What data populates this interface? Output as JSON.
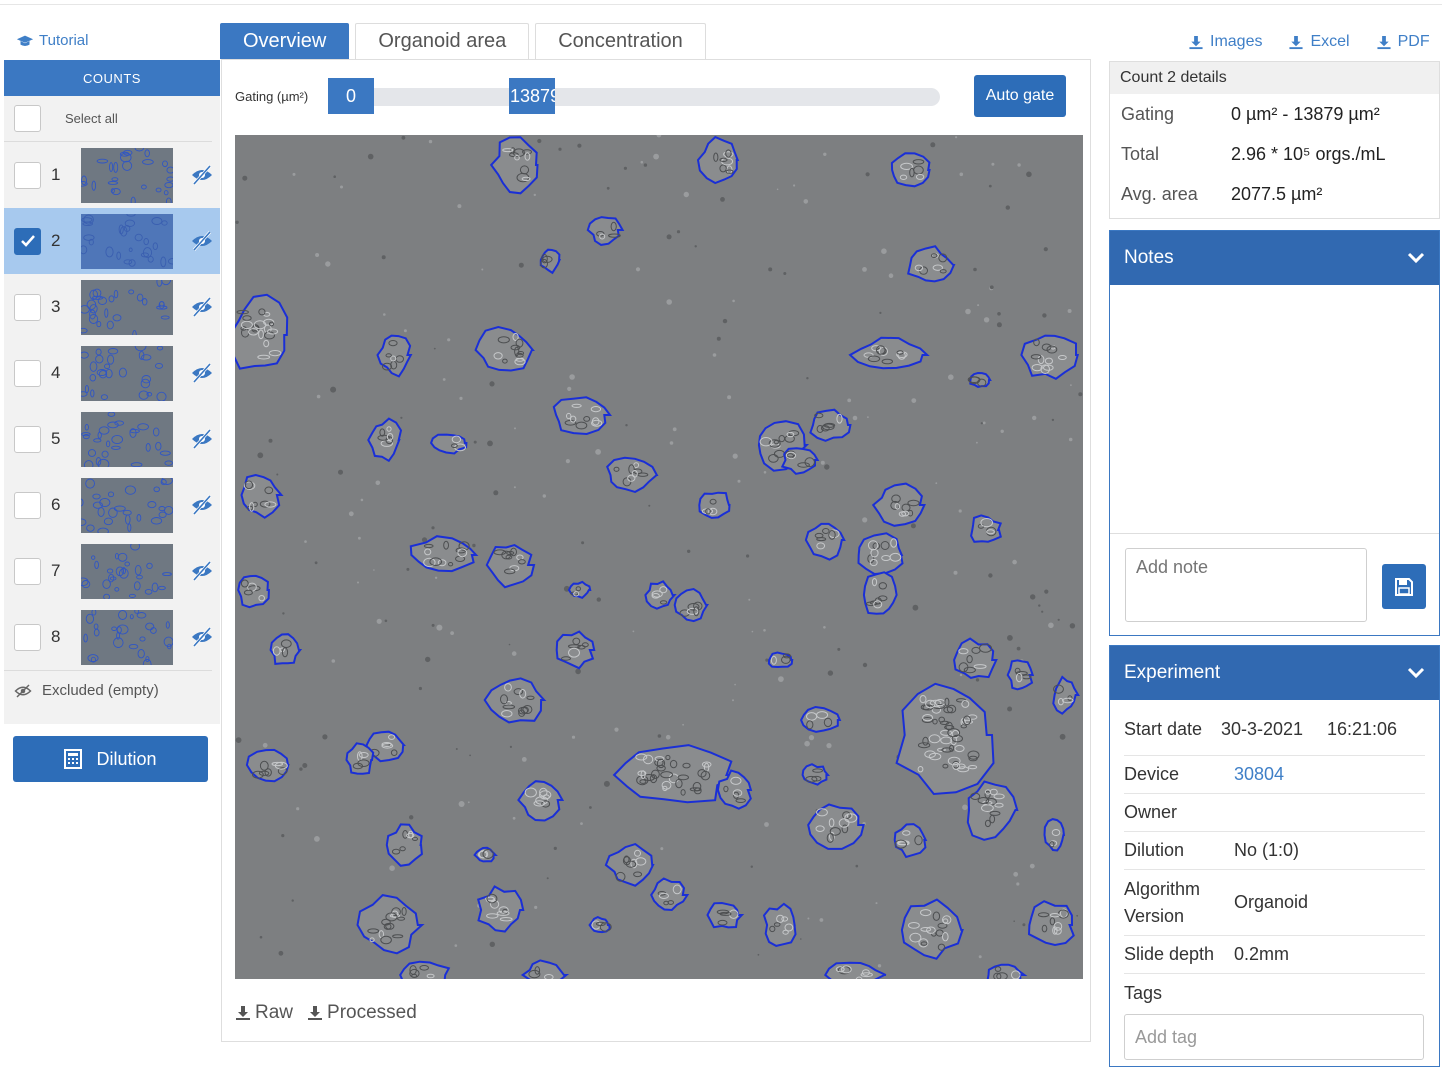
{
  "sidebar": {
    "tutorial_label": "Tutorial",
    "counts_header": "COUNTS",
    "select_all_label": "Select all",
    "items": [
      {
        "label": "1",
        "checked": false
      },
      {
        "label": "2",
        "checked": true
      },
      {
        "label": "3",
        "checked": false
      },
      {
        "label": "4",
        "checked": false
      },
      {
        "label": "5",
        "checked": false
      },
      {
        "label": "6",
        "checked": false
      },
      {
        "label": "7",
        "checked": false
      },
      {
        "label": "8",
        "checked": false
      }
    ],
    "excluded_label": "Excluded (empty)",
    "dilution_label": "Dilution"
  },
  "tabs": [
    {
      "label": "Overview",
      "active": true
    },
    {
      "label": "Organoid area",
      "active": false
    },
    {
      "label": "Concentration",
      "active": false
    }
  ],
  "gating": {
    "label": "Gating (µm²)",
    "min_value": "0",
    "max_value": "13879",
    "auto_gate_label": "Auto gate"
  },
  "downloads": {
    "raw_label": "Raw",
    "processed_label": "Processed"
  },
  "export": {
    "images_label": "Images",
    "excel_label": "Excel",
    "pdf_label": "PDF"
  },
  "details": {
    "title": "Count 2 details",
    "rows": [
      {
        "key": "Gating",
        "value": "0 µm² - 13879 µm²"
      },
      {
        "key": "Total",
        "value": "2.96 * 10⁵ orgs./mL"
      },
      {
        "key": "Avg. area",
        "value": "2077.5 µm²"
      }
    ]
  },
  "notes": {
    "title": "Notes",
    "placeholder": "Add note"
  },
  "experiment": {
    "title": "Experiment",
    "start_date_label": "Start date",
    "start_date": "30-3-2021",
    "start_time": "16:21:06",
    "device_label": "Device",
    "device_value": "30804",
    "owner_label": "Owner",
    "dilution_label": "Dilution",
    "dilution_value": "No (1:0)",
    "algorithm_label_1": "Algorithm",
    "algorithm_label_2": "Version",
    "algorithm_value": "Organoid",
    "slide_depth_label": "Slide depth",
    "slide_depth_value": "0.2mm",
    "tags_label": "Tags",
    "tag_placeholder": "Add tag"
  },
  "colors": {
    "primary": "#3b78c2",
    "button": "#2d6db8",
    "link": "#3f7fc7",
    "selected_row": "#a7c9ee",
    "contour": "#1a2fd6"
  }
}
